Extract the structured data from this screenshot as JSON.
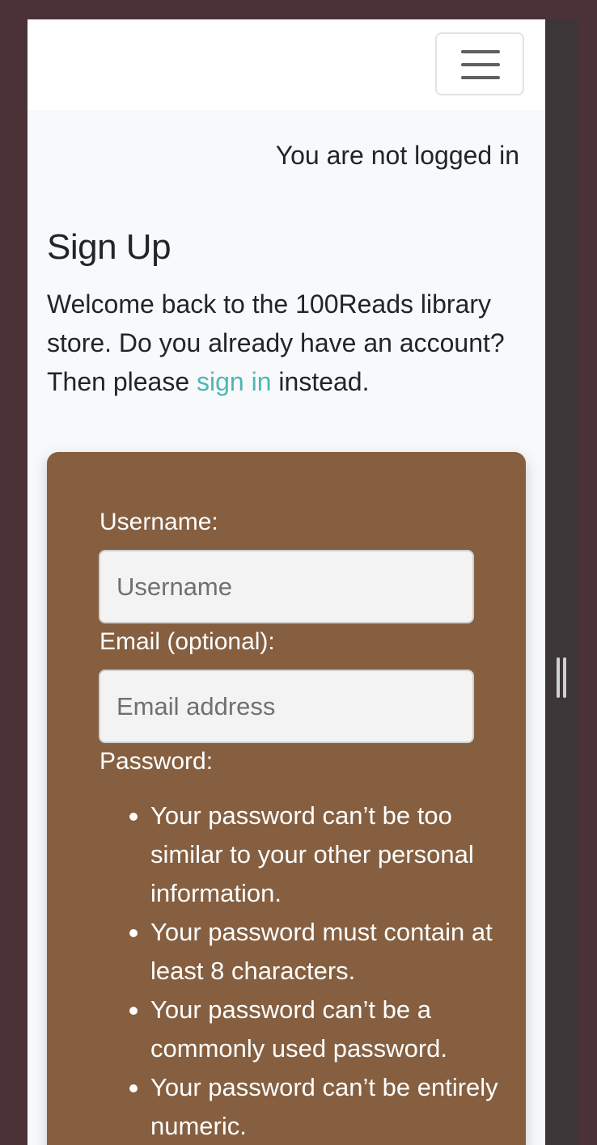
{
  "navbar": {
    "toggler_icon": "hamburger-menu-icon"
  },
  "auth_status": "You are not logged in",
  "page": {
    "title": "Sign Up",
    "intro_before": "Welcome back to the 100Reads library store. Do you already have an account? Then please ",
    "intro_link": "sign in",
    "intro_after": " instead."
  },
  "form": {
    "username": {
      "label": "Username:",
      "placeholder": "Username",
      "value": ""
    },
    "email": {
      "label": "Email (optional):",
      "placeholder": "Email address",
      "value": ""
    },
    "password": {
      "label": "Password:",
      "help": [
        "Your password can’t be too similar to your other personal information.",
        "Your password must contain at least 8 characters.",
        "Your password can’t be a commonly used password.",
        "Your password can’t be entirely numeric."
      ]
    }
  },
  "colors": {
    "card_background": "#855f40",
    "link": "#4fb6b6",
    "page_background": "#f8f9fa"
  }
}
